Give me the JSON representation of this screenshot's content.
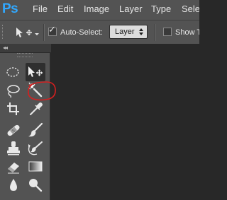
{
  "app": {
    "logo": "Ps"
  },
  "menubar": {
    "items": [
      {
        "label": "File"
      },
      {
        "label": "Edit"
      },
      {
        "label": "Image"
      },
      {
        "label": "Layer"
      },
      {
        "label": "Type"
      },
      {
        "label": "Selec"
      }
    ]
  },
  "options": {
    "auto_select_label": "Auto-Select:",
    "auto_select_checked": true,
    "target_value": "Layer",
    "show_transform_label": "Show T",
    "show_transform_checked": false
  },
  "tools": {
    "collapse_glyph": "◂◂",
    "items": [
      {
        "name": "elliptical-marquee"
      },
      {
        "name": "move",
        "active": true
      },
      {
        "name": "lasso"
      },
      {
        "name": "magic-wand",
        "highlighted": true
      },
      {
        "name": "crop"
      },
      {
        "name": "eyedropper"
      },
      {
        "name": "spot-healing-brush"
      },
      {
        "name": "brush"
      },
      {
        "name": "clone-stamp"
      },
      {
        "name": "history-brush"
      },
      {
        "name": "eraser"
      },
      {
        "name": "gradient"
      },
      {
        "name": "blur"
      },
      {
        "name": "dodge"
      }
    ]
  },
  "colors": {
    "chrome": "#535353",
    "canvas": "#282828",
    "ps_blue": "#31a8ff",
    "annotation_red": "#d42020"
  }
}
